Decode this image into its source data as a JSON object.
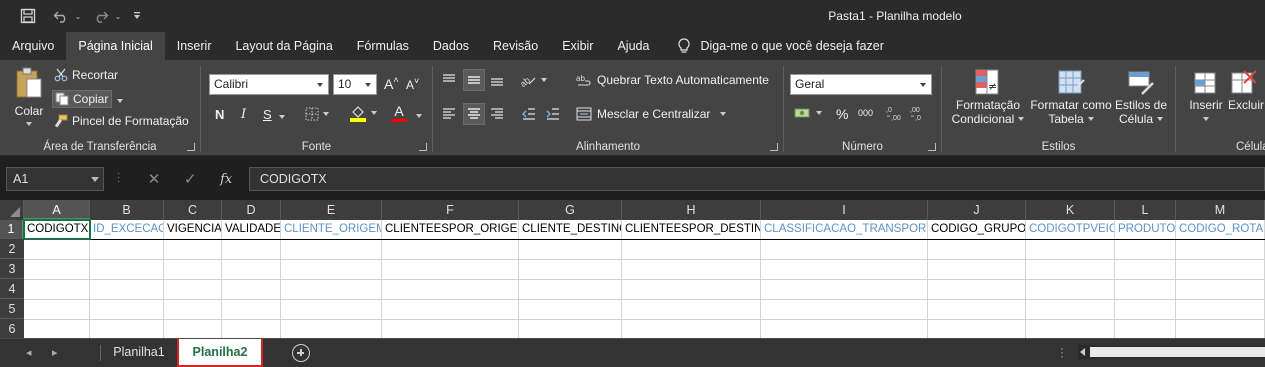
{
  "titlebar": {
    "document_title": "Pasta1  -  Planilha modelo",
    "quick_access": [
      "save-icon",
      "undo-icon",
      "redo-icon",
      "customize-qat-icon"
    ]
  },
  "ribbon_tabs": [
    "Arquivo",
    "Página Inicial",
    "Inserir",
    "Layout da Página",
    "Fórmulas",
    "Dados",
    "Revisão",
    "Exibir",
    "Ajuda"
  ],
  "active_tab": "Página Inicial",
  "tell_me": "Diga-me o que você deseja fazer",
  "clipboard": {
    "paste": "Colar",
    "cut": "Recortar",
    "copy": "Copiar",
    "format_painter": "Pincel de Formatação",
    "label": "Área de Transferência"
  },
  "font": {
    "family": "Calibri",
    "size": "10",
    "label": "Fonte",
    "increase": "A",
    "decrease": "A",
    "bold": "N",
    "italic": "I",
    "underline": "S",
    "font_color_letter": "A",
    "fill_color": "#ffff00",
    "font_color": "#ff0000"
  },
  "alignment": {
    "wrap_text": "Quebrar Texto Automaticamente",
    "merge_center": "Mesclar e Centralizar",
    "label": "Alinhamento"
  },
  "number": {
    "format": "Geral",
    "percent": "%",
    "thousands": "000",
    "label": "Número"
  },
  "styles": {
    "conditional_line1": "Formatação",
    "conditional_line2": "Condicional",
    "format_table_line1": "Formatar como",
    "format_table_line2": "Tabela",
    "cell_styles_line1": "Estilos de",
    "cell_styles_line2": "Célula",
    "label": "Estilos"
  },
  "cells_group": {
    "insert": "Inserir",
    "delete": "Excluir",
    "label": "Célula"
  },
  "formula_bar": {
    "name_box": "A1",
    "fx": "fx",
    "content": "CODIGOTX"
  },
  "columns": [
    "A",
    "B",
    "C",
    "D",
    "E",
    "F",
    "G",
    "H",
    "I",
    "J",
    "K",
    "L",
    "M"
  ],
  "rows": [
    "1",
    "2",
    "3",
    "4",
    "5",
    "6"
  ],
  "row1_cells": [
    "CODIGOTX",
    "ID_EXCECAO",
    "VIGENCIA",
    "VALIDADE",
    "CLIENTE_ORIGEM",
    "CLIENTEESPOR_ORIGEM",
    "CLIENTE_DESTINO",
    "CLIENTEESPOR_DESTINO",
    "CLASSIFICACAO_TRANSPORTE",
    "CODIGO_GRUPO",
    "CODIGOTPVEIC",
    "PRODUTO",
    "CODIGO_ROTA"
  ],
  "colors": {
    "header_text_blue": "#5b93c9",
    "active_sheet_green": "#1e7145",
    "highlight_red": "#d9261c"
  },
  "sheets": [
    "Planilha1",
    "Planilha2"
  ],
  "active_sheet": "Planilha2"
}
